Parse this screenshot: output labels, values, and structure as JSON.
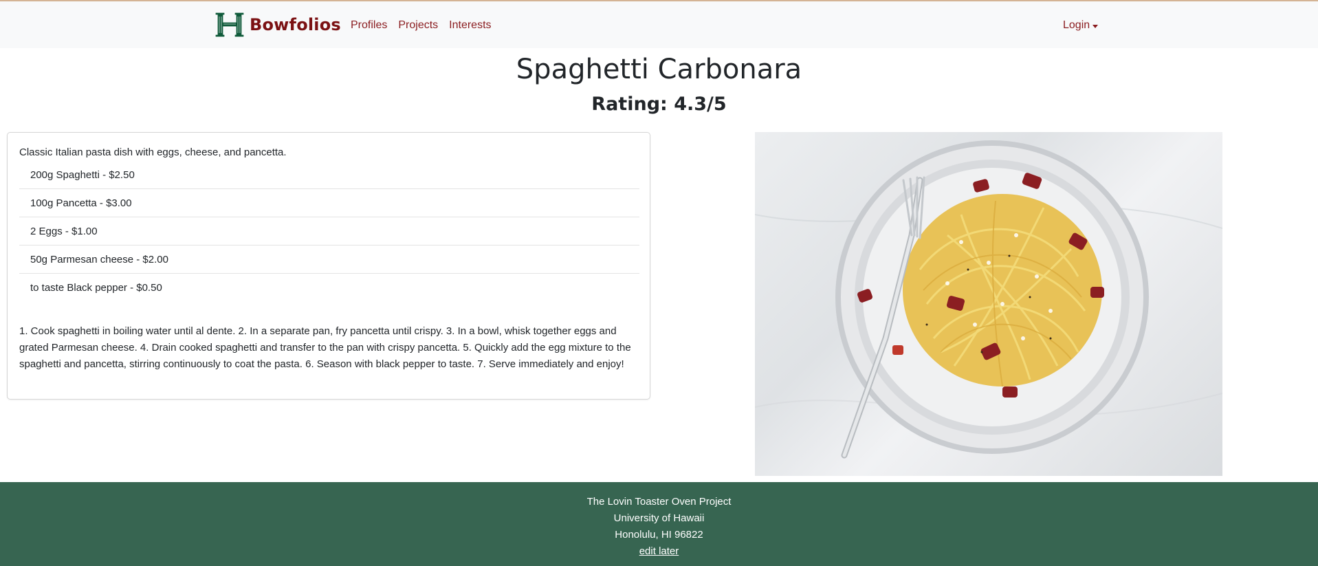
{
  "nav": {
    "brand": "Bowfolios",
    "links": [
      "Profiles",
      "Projects",
      "Interests"
    ],
    "login": "Login"
  },
  "recipe": {
    "title": "Spaghetti Carbonara",
    "rating": "Rating: 4.3/5",
    "description": "Classic Italian pasta dish with eggs, cheese, and pancetta.",
    "ingredients": [
      "200g Spaghetti - $2.50",
      "100g Pancetta - $3.00",
      "2 Eggs - $1.00",
      "50g Parmesan cheese - $2.00",
      "to taste Black pepper - $0.50"
    ],
    "instructions": "1. Cook spaghetti in boiling water until al dente. 2. In a separate pan, fry pancetta until crispy. 3. In a bowl, whisk together eggs and grated Parmesan cheese. 4. Drain cooked spaghetti and transfer to the pan with crispy pancetta. 5. Quickly add the egg mixture to the spaghetti and pancetta, stirring continuously to coat the pasta. 6. Season with black pepper to taste. 7. Serve immediately and enjoy!"
  },
  "footer": {
    "lines": [
      "The Lovin Toaster Oven Project",
      "University of Hawaii",
      "Honolulu, HI 96822"
    ],
    "link": "edit later"
  },
  "colors": {
    "brand": "#7b1113",
    "nav_link": "#8a1c1f",
    "footer_bg": "#376551",
    "topbar_bg": "#f8f9fa"
  }
}
